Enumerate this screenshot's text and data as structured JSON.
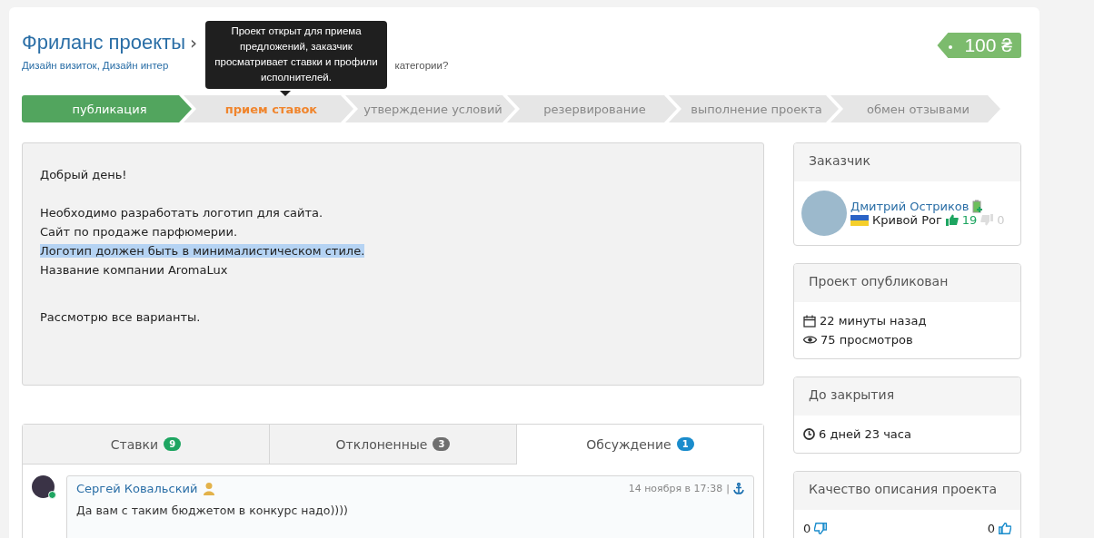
{
  "breadcrumb": {
    "root": "Фриланс проекты",
    "separator": "›"
  },
  "categories": [
    "Дизайн визиток,",
    "Дизайн интер"
  ],
  "category_hint": "категории?",
  "price": "100 ₴",
  "tooltip": "Проект открыт для приема предложений, заказчик просматривает ставки и профили исполнителей.",
  "steps": [
    {
      "label": "публикация",
      "done": true,
      "selected": false
    },
    {
      "label": "прием ставок",
      "done": false,
      "selected": true
    },
    {
      "label": "утверждение условий",
      "done": false,
      "selected": false
    },
    {
      "label": "резервирование",
      "done": false,
      "selected": false
    },
    {
      "label": "выполнение проекта",
      "done": false,
      "selected": false
    },
    {
      "label": "обмен отзывами",
      "done": false,
      "selected": false
    }
  ],
  "description": [
    {
      "lines": [
        {
          "text": "Добрый день!",
          "highlighted": false
        }
      ]
    },
    {
      "lines": [
        {
          "text": "Необходимо разработать логотип для сайта.",
          "highlighted": false
        },
        {
          "text": "Сайт по продаже парфюмерии.",
          "highlighted": false
        },
        {
          "text": "Логотип должен быть в минималистическом стиле.",
          "highlighted": true
        },
        {
          "text": "Название компании AromaLux",
          "highlighted": false
        }
      ]
    },
    {
      "lines": [
        {
          "text": "Рассмотрю все варианты.",
          "highlighted": false
        }
      ]
    }
  ],
  "tabs": [
    {
      "label": "Ставки",
      "count": "9",
      "color": "#1ea561",
      "selected": false
    },
    {
      "label": "Отклоненные",
      "count": "3",
      "color": "#6f6f6f",
      "selected": false
    },
    {
      "label": "Обсуждение",
      "count": "1",
      "color": "#1a8ccc",
      "selected": true
    }
  ],
  "comment": {
    "author": "Сергей Ковальский",
    "online": true,
    "date": "14 ноября в 17:38",
    "divider": "|",
    "text": "Да вам с таким бюджетом в конкурс надо))))"
  },
  "sidebar": {
    "customer": {
      "title": "Заказчик",
      "name": "Дмитрий Остриков",
      "city": "Кривой Рог",
      "likes": "19",
      "dislikes": "0"
    },
    "published": {
      "title": "Проект опубликован",
      "time": "22 минуты назад",
      "views": "75 просмотров"
    },
    "closing": {
      "title": "До закрытия",
      "remaining": "6 дней 23 часа"
    },
    "quality": {
      "title": "Качество описания проекта",
      "down": "0",
      "up": "0"
    }
  }
}
